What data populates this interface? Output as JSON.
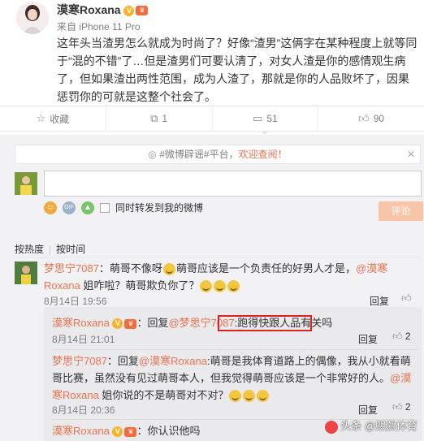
{
  "post": {
    "author": "漠寒Roxana",
    "badge_v": "V",
    "badge_vip": "会员",
    "source": "来自 iPhone 11 Pro",
    "text": "这年头当渣男怎么就成为时尚了？好像“渣男”这俩字在某种程度上就等同于“混的不错”了…但是渣男们可要认清了，对女人渣是你的感情观生病了，但如果渣出两性范围，成为人渣了，那就是你的人品败坏了，因果惩罚你的可就是这整个社会了。"
  },
  "actions": {
    "favorite": "收藏",
    "repost_count": "1",
    "comment_count": "51",
    "like_count": "90"
  },
  "comment_box": {
    "tag_text": "#微博辟谣#平台，",
    "tag_welcome": "欢迎查阅！",
    "close": "✕",
    "forward_label": "同时转发到我的微博",
    "submit": "评论"
  },
  "sort": {
    "by_hot": "按热度",
    "by_time": "按时间"
  },
  "comments": [
    {
      "user": "梦思宁7087",
      "text_a": "：萌哥不像呀",
      "text_b": "萌哥应该是一个负责任的好男人才是，",
      "mention": "@漠寒Roxana",
      "text_c": " 姐咋啦？萌哥欺负你了？",
      "time": "8月14日 19:56",
      "reply": "回复",
      "like": "赞"
    }
  ],
  "replies": [
    {
      "user": "漠寒Roxana",
      "prefix": "：回复",
      "mention": "@梦思宁7087",
      "text": ":跑得快跟人品有关吗",
      "time": "8月14日 21:01",
      "reply": "回复",
      "like_count": "2"
    },
    {
      "user": "梦思宁7087",
      "prefix": "：回复",
      "mention": "@漠寒Roxana",
      "text": ":萌哥是我体育道路上的偶像，我从小就看萌哥比赛，虽然没有见过萌哥本人，但我觉得萌哥应该是一个非常好的人。",
      "mention2": "@漠寒Roxana",
      "text2": " 姐你说的不是萌哥对不对？",
      "time": "8月14日 20:36",
      "reply": "回复",
      "like_count": "2"
    },
    {
      "user": "漠寒Roxana",
      "text": "：你认识他吗"
    }
  ],
  "watermark": "头条 @熙熙体育"
}
